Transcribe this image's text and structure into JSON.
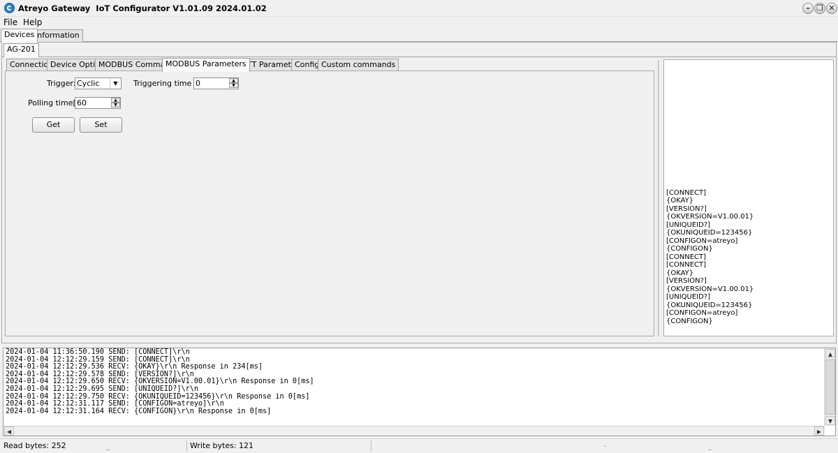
{
  "window": {
    "title": "Atreyo Gateway  IoT Configurator V1.01.09 2024.01.02",
    "minimize_glyph": "–",
    "restore_glyph": "❐",
    "close_glyph": "✕"
  },
  "menu": [
    "File",
    "Help"
  ],
  "top_tabs": [
    "Devices",
    "Information"
  ],
  "device_tabs": [
    "AG-201"
  ],
  "config_tabs": [
    "Connection",
    "Device Option",
    "MODBUS Commands",
    "MODBUS Parameters",
    "MQTT Parameters",
    "Config",
    "Custom commands"
  ],
  "active_config_tab": "MODBUS Parameters",
  "form": {
    "trigger_label": "Trigger:",
    "trigger_value": "Cyclic",
    "triggering_time_label": "Triggering time [s]:",
    "triggering_time_value": "0",
    "polling_time_label": "Polling time[s]:",
    "polling_time_value": "60",
    "get_button": "Get",
    "set_button": "Set"
  },
  "response_lines": [
    "[CONNECT]",
    "{OKAY}",
    "[VERSION?]",
    "{OKVERSION=V1.00.01}",
    "[UNIQUEID?]",
    "{OKUNIQUEID=123456}",
    "[CONFIGON=atreyo]",
    "{CONFIGON}",
    "[CONNECT]",
    "[CONNECT]",
    "{OKAY}",
    "[VERSION?]",
    "{OKVERSION=V1.00.01}",
    "[UNIQUEID?]",
    "{OKUNIQUEID=123456}",
    "[CONFIGON=atreyo]",
    "{CONFIGON}"
  ],
  "log_lines": [
    "2024-01-04 11:36:50.190 SEND: [CONNECT]\\r\\n",
    "2024-01-04 12:12:29.159 SEND: [CONNECT]\\r\\n",
    "2024-01-04 12:12:29.536 RECV: {OKAY}\\r\\n Response in 234[ms]",
    "2024-01-04 12:12:29.578 SEND: [VERSION?]\\r\\n",
    "2024-01-04 12:12:29.650 RECV: {OKVERSION=V1.00.01}\\r\\n Response in 0[ms]",
    "2024-01-04 12:12:29.695 SEND: [UNIQUEID?]\\r\\n",
    "2024-01-04 12:12:29.750 RECV: {OKUNIQUEID=123456}\\r\\n Response in 0[ms]",
    "2024-01-04 12:12:31.117 SEND: [CONFIGON=atreyo]\\r\\n",
    "2024-01-04 12:12:31.164 RECV: {CONFIGON}\\r\\n Response in 0[ms]"
  ],
  "status": {
    "read_bytes": "Read bytes: 252",
    "write_bytes": "Write bytes: 121",
    "mark1": "_",
    "mark2": "-",
    "mark3": "_"
  }
}
